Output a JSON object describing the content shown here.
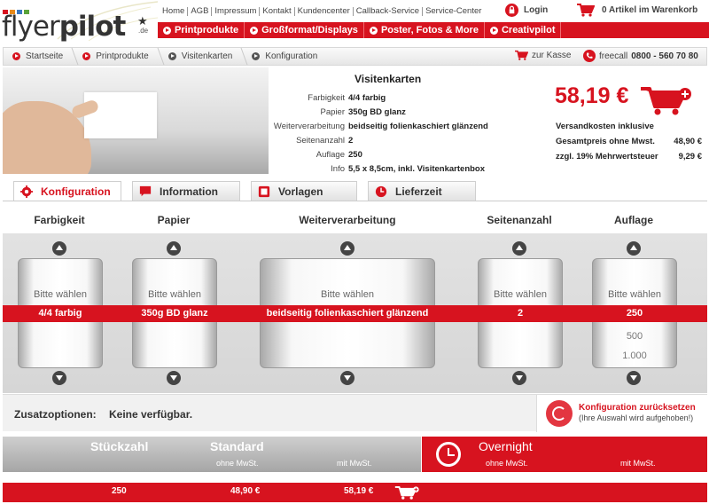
{
  "header": {
    "logo_text_1": "flyer",
    "logo_text_2": "pilot",
    "logo_star": "★",
    "logo_tld": ".de",
    "logo_dot_colors": [
      "#d7131f",
      "#e88a1a",
      "#3a78c2",
      "#5aa33a"
    ],
    "toplinks": [
      "Home",
      "AGB",
      "Impressum",
      "Kontakt",
      "Kundencenter",
      "Callback-Service",
      "Service-Center"
    ],
    "login_label": "Login",
    "cart_label": "0 Artikel im Warenkorb",
    "nav": [
      "Printprodukte",
      "Großformat/Displays",
      "Poster, Fotos & More",
      "Creativpilot"
    ]
  },
  "breadcrumb": {
    "items": [
      "Startseite",
      "Printprodukte",
      "Visitenkarten",
      "Konfiguration"
    ],
    "checkout_label": "zur Kasse",
    "freecall_label": "freecall",
    "freecall_number": "0800 - 560 70 80"
  },
  "product": {
    "title": "Visitenkarten",
    "specs": [
      {
        "key": "Farbigkeit",
        "value": "4/4 farbig"
      },
      {
        "key": "Papier",
        "value": "350g BD glanz"
      },
      {
        "key": "Weiterverarbeitung",
        "value": "beidseitig folienkaschiert glänzend"
      },
      {
        "key": "Seitenanzahl",
        "value": "2"
      },
      {
        "key": "Auflage",
        "value": "250"
      },
      {
        "key": "Info",
        "value": "5,5 x 8,5cm, inkl. Visitenkartenbox"
      }
    ],
    "price": "58,19 €",
    "shipping": "Versandkosten inklusive",
    "net_label": "Gesamtpreis ohne Mwst.",
    "net_value": "48,90 €",
    "vat_label": "zzgl. 19% Mehrwertsteuer",
    "vat_value": "9,29 €"
  },
  "tabs": [
    {
      "label": "Konfiguration",
      "icon": "gear-icon",
      "active": true
    },
    {
      "label": "Information",
      "icon": "speech-bubble-icon",
      "active": false
    },
    {
      "label": "Vorlagen",
      "icon": "document-icon",
      "active": false
    },
    {
      "label": "Lieferzeit",
      "icon": "clock-icon",
      "active": false
    }
  ],
  "configurator": {
    "columns": [
      {
        "header": "Farbigkeit",
        "placeholder": "Bitte wählen",
        "selected": "4/4 farbig",
        "below": []
      },
      {
        "header": "Papier",
        "placeholder": "Bitte wählen",
        "selected": "350g BD glanz",
        "below": []
      },
      {
        "header": "Weiterverarbeitung",
        "placeholder": "Bitte wählen",
        "selected": "beidseitig folienkaschiert glänzend",
        "below": []
      },
      {
        "header": "Seitenanzahl",
        "placeholder": "Bitte wählen",
        "selected": "2",
        "below": []
      },
      {
        "header": "Auflage",
        "placeholder": "Bitte wählen",
        "selected": "250",
        "below": [
          "500",
          "1.000"
        ]
      }
    ]
  },
  "extras": {
    "label": "Zusatzoptionen:",
    "value": "Keine verfügbar.",
    "reset_title": "Konfiguration zurücksetzen",
    "reset_sub": "(Ihre Auswahl wird aufgehoben!)"
  },
  "pricing": {
    "qty_header": "Stückzahl",
    "standard_title": "Standard",
    "standard_ohne": "ohne MwSt.",
    "standard_mit": "mit MwSt.",
    "overnight_title": "Overnight",
    "overnight_ohne": "ohne MwSt.",
    "overnight_mit": "mit MwSt.",
    "row": {
      "qty": "250",
      "ohne": "48,90 €",
      "mit": "58,19 €"
    }
  },
  "colors": {
    "brand_red": "#d7131f",
    "band_gray": "#d6d6d6"
  }
}
